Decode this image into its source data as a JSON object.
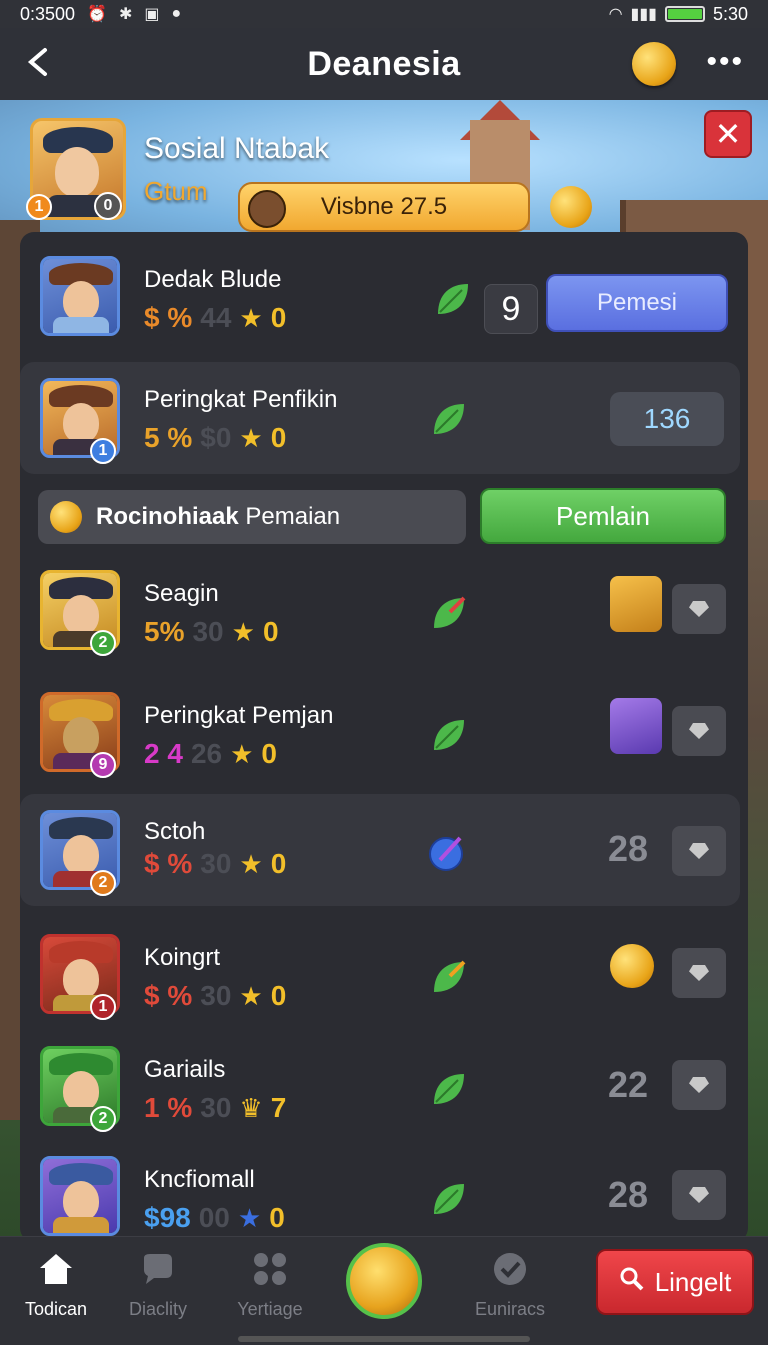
{
  "status": {
    "time_left": "0:3500",
    "time_right": "5:30",
    "battery_percent": 100
  },
  "appbar": {
    "title": "Deanesia"
  },
  "header": {
    "name": "Sosial Ntabak",
    "sub": "Gtum",
    "level_badge": "1",
    "rank_badge": "0",
    "pill_label": "Visbne 27.5"
  },
  "rows": [
    {
      "name": "Dedak Blude",
      "pct": "$ %",
      "dim": "44",
      "stars": "0",
      "badge": "",
      "box": "9",
      "action": "Pemesi"
    },
    {
      "name": "Peringkat Penfikin",
      "pct": "5 %",
      "dim": "$0",
      "stars": "0",
      "badge": "1",
      "value": "136"
    },
    {
      "name": "Seagin",
      "pct": "5%",
      "dim": "30",
      "stars": "0",
      "badge": "2"
    },
    {
      "name": "Peringkat  Pemjan",
      "pct": "2 4",
      "dim": "26",
      "stars": "0",
      "badge": "9"
    },
    {
      "name": "Sctoh",
      "pct": "$ %",
      "dim": "30",
      "stars": "0",
      "badge": "2",
      "num": "28"
    },
    {
      "name": "Koingrt",
      "pct": "$ %",
      "dim": "30",
      "stars": "0",
      "badge": "1"
    },
    {
      "name": "Gariails",
      "pct": "1 %",
      "dim": "30",
      "stars": "7",
      "badge": "2",
      "num": "22"
    },
    {
      "name": "Kncfiomall",
      "pct": "$98",
      "dim": "00",
      "stars": "0",
      "badge": "",
      "num": "28"
    }
  ],
  "midbar": {
    "bold": "Rocinohiaak",
    "rest": " Pemaian",
    "button": "Pemlain"
  },
  "tabs": [
    {
      "label": "Todican",
      "icon": "home-icon"
    },
    {
      "label": "Diaclity",
      "icon": "chat-icon"
    },
    {
      "label": "Yertiage",
      "icon": "grid-icon"
    },
    {
      "label": "Euniracs",
      "icon": "check-icon"
    }
  ],
  "search_button": "Lingelt",
  "colors": {
    "accent_blue": "#5a6fe0",
    "accent_green": "#44a83e",
    "accent_red": "#d9333a",
    "gold": "#f2bf2a"
  }
}
